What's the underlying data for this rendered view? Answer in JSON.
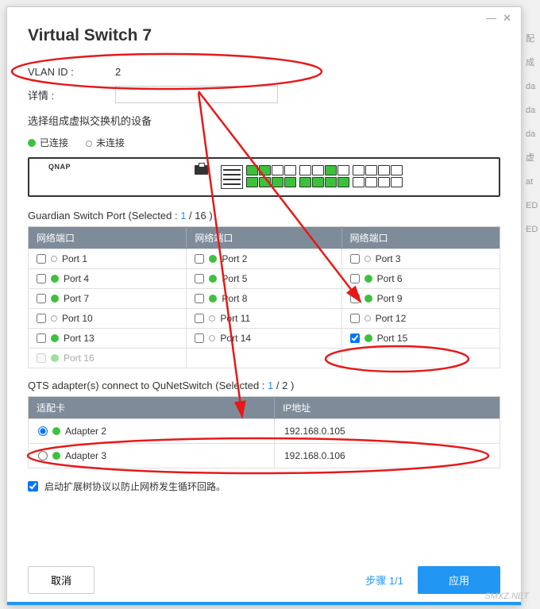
{
  "titlebar": {
    "minimize": "—",
    "close": "✕"
  },
  "title": "Virtual Switch 7",
  "vlan": {
    "label": "VLAN ID :",
    "value": "2"
  },
  "details": {
    "label": "详情 :",
    "value": ""
  },
  "section_devices": "选择组成虚拟交换机的设备",
  "legend": {
    "connected": "已连接",
    "disconnected": "未连接"
  },
  "device_brand": "QNAP",
  "guardian": {
    "title_prefix": "Guardian Switch Port (Selected : ",
    "selected": "1",
    "total": " / 16 )",
    "header": "网络端口",
    "ports": [
      {
        "name": "Port 1",
        "on": false,
        "chk": false
      },
      {
        "name": "Port 2",
        "on": true,
        "chk": false
      },
      {
        "name": "Port 3",
        "on": false,
        "chk": false
      },
      {
        "name": "Port 4",
        "on": true,
        "chk": false
      },
      {
        "name": "Port 5",
        "on": true,
        "chk": false
      },
      {
        "name": "Port 6",
        "on": true,
        "chk": false
      },
      {
        "name": "Port 7",
        "on": true,
        "chk": false
      },
      {
        "name": "Port 8",
        "on": true,
        "chk": false
      },
      {
        "name": "Port 9",
        "on": true,
        "chk": false
      },
      {
        "name": "Port 10",
        "on": false,
        "chk": false
      },
      {
        "name": "Port 11",
        "on": false,
        "chk": false
      },
      {
        "name": "Port 12",
        "on": false,
        "chk": false
      },
      {
        "name": "Port 13",
        "on": true,
        "chk": false
      },
      {
        "name": "Port 14",
        "on": false,
        "chk": false
      },
      {
        "name": "Port 15",
        "on": true,
        "chk": true
      },
      {
        "name": "Port 16",
        "on": true,
        "chk": false,
        "dis": true
      }
    ]
  },
  "qts": {
    "title_prefix": "QTS adapter(s) connect to QuNetSwitch (Selected : ",
    "selected": "1",
    "total": " / 2 )",
    "col1": "适配卡",
    "col2": "IP地址",
    "adapters": [
      {
        "name": "Adapter 2",
        "ip": "192.168.0.105",
        "sel": true,
        "on": true
      },
      {
        "name": "Adapter 3",
        "ip": "192.168.0.106",
        "sel": false,
        "on": true
      }
    ]
  },
  "stp": {
    "label": "启动扩展树协议以防止网桥发生循环回路。"
  },
  "footer": {
    "cancel": "取消",
    "step": "步骤 1/1",
    "apply": "应用"
  },
  "watermark": "SMXZ.NET"
}
